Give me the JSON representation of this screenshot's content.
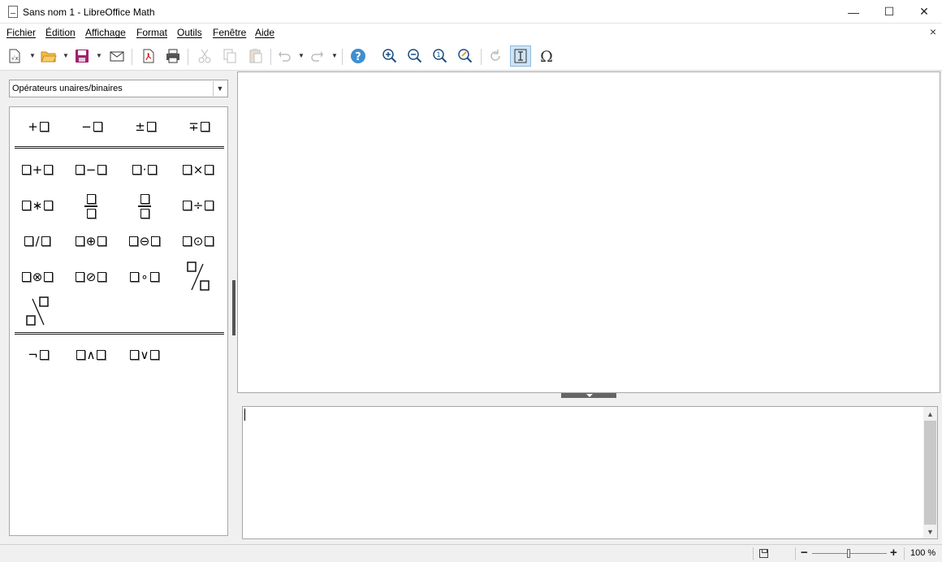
{
  "window": {
    "title": "Sans nom 1 - LibreOffice Math",
    "minimize": "—",
    "maximize": "☐",
    "close": "✕"
  },
  "menu": {
    "items": [
      {
        "label": "Fichier"
      },
      {
        "label": "Édition"
      },
      {
        "label": "Affichage"
      },
      {
        "label": "Format"
      },
      {
        "label": "Outils"
      },
      {
        "label": "Fenêtre"
      },
      {
        "label": "Aide"
      }
    ],
    "close_doc": "×"
  },
  "toolbar": {
    "buttons": [
      {
        "name": "new-document",
        "icon": "new-document-icon"
      },
      {
        "name": "open",
        "icon": "folder-open-icon"
      },
      {
        "name": "save",
        "icon": "save-icon"
      },
      {
        "name": "email",
        "icon": "mail-icon"
      },
      {
        "name": "export-pdf",
        "icon": "pdf-icon"
      },
      {
        "name": "print",
        "icon": "printer-icon"
      },
      {
        "name": "cut",
        "icon": "scissors-icon",
        "disabled": true
      },
      {
        "name": "copy",
        "icon": "copy-icon",
        "disabled": true
      },
      {
        "name": "paste",
        "icon": "paste-icon",
        "disabled": true
      },
      {
        "name": "undo",
        "icon": "undo-icon",
        "disabled": true
      },
      {
        "name": "redo",
        "icon": "redo-icon",
        "disabled": true
      },
      {
        "name": "help",
        "icon": "help-icon"
      },
      {
        "name": "zoom-in",
        "icon": "zoom-in-icon"
      },
      {
        "name": "zoom-out",
        "icon": "zoom-out-icon"
      },
      {
        "name": "zoom-100",
        "icon": "zoom-100-icon"
      },
      {
        "name": "show-all",
        "icon": "zoom-fit-icon"
      },
      {
        "name": "update",
        "icon": "refresh-icon",
        "disabled": true
      },
      {
        "name": "formula-cursor",
        "icon": "text-cursor-icon",
        "active": true
      },
      {
        "name": "symbols",
        "icon": "omega-icon"
      }
    ]
  },
  "elements_panel": {
    "category": "Opérateurs unaires/binaires",
    "unary": [
      "+",
      "−",
      "±",
      "∓"
    ],
    "binary_ops": [
      "+",
      "−",
      "·",
      "×",
      "∗",
      "÷",
      "/",
      "⊕",
      "⊖",
      "⊙",
      "⊗",
      "⊘",
      "∘"
    ],
    "logic": [
      "¬",
      "∧",
      "∨"
    ]
  },
  "status": {
    "zoom_minus": "−",
    "zoom_plus": "+",
    "zoom": "100 %"
  },
  "colors": {
    "accent": "#3e8ed0",
    "active_bg": "#cde4f7"
  }
}
